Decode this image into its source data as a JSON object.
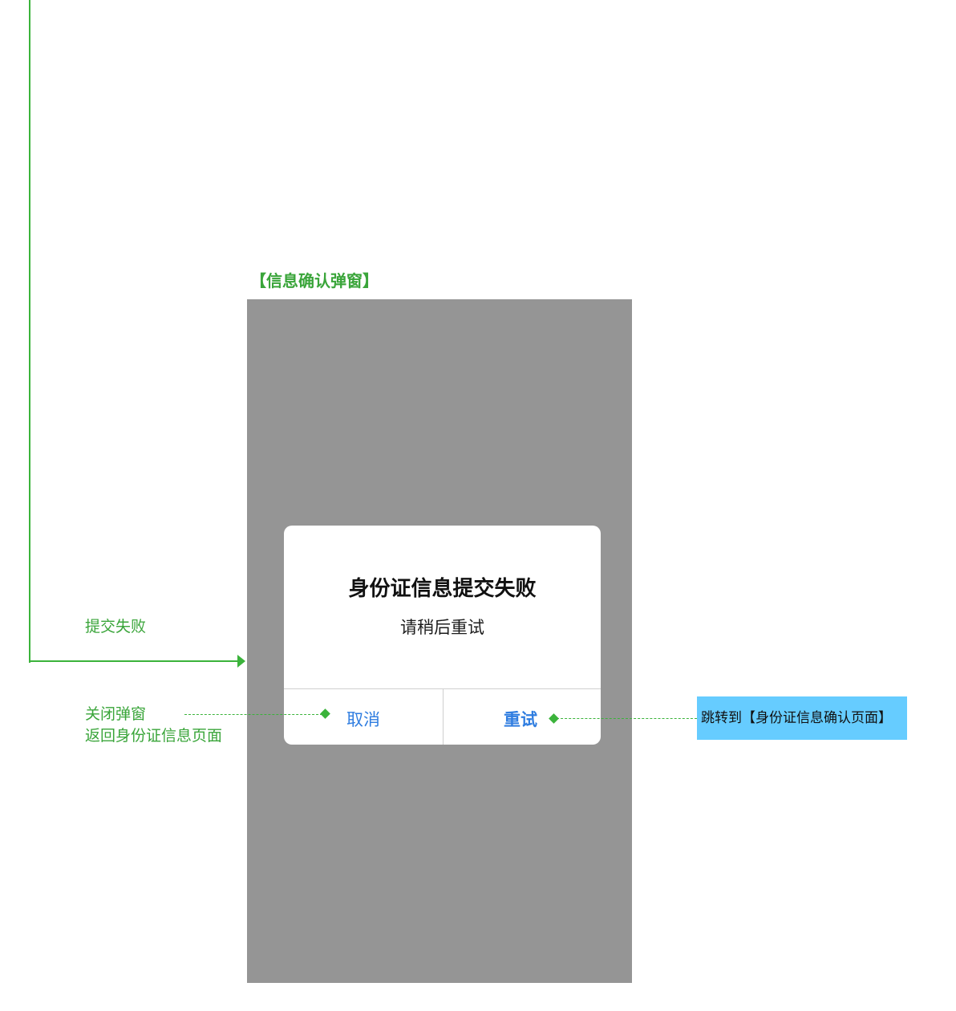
{
  "flow": {
    "submit_fail_label": "提交失败",
    "cancel_note_line1": "关闭弹窗",
    "cancel_note_line2": "返回身份证信息页面",
    "retry_note": "跳转到【身份证信息确认页面】"
  },
  "screen": {
    "title": "【信息确认弹窗】"
  },
  "dialog": {
    "title": "身份证信息提交失败",
    "message": "请稍后重试",
    "cancel_label": "取消",
    "retry_label": "重试"
  },
  "colors": {
    "annotation_green": "#3bb33b",
    "overlay_gray": "#959595",
    "button_blue": "#2f7de0",
    "note_blue": "#66ccff"
  }
}
